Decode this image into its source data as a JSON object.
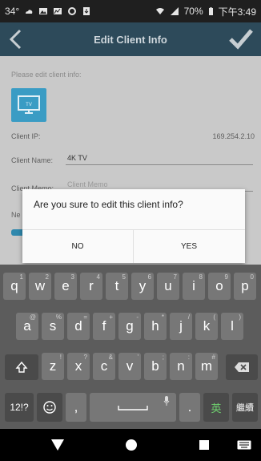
{
  "status_bar": {
    "left_text": "34°",
    "battery": "70%",
    "time": "下午3:49"
  },
  "app_bar": {
    "title": "Edit Client Info"
  },
  "form": {
    "hint": "Please edit client info:",
    "tv_label": "TV",
    "ip_label": "Client IP:",
    "ip_value": "169.254.2.10",
    "name_label": "Client Name:",
    "name_value": "4K TV",
    "memo_label": "Client Memo:",
    "memo_placeholder": "Client Memo",
    "ne_label": "Ne"
  },
  "dialog": {
    "message": "Are you sure to edit this client info?",
    "no_label": "NO",
    "yes_label": "YES"
  },
  "keyboard": {
    "row1": [
      {
        "k": "q",
        "h": "1"
      },
      {
        "k": "w",
        "h": "2"
      },
      {
        "k": "e",
        "h": "3"
      },
      {
        "k": "r",
        "h": "4"
      },
      {
        "k": "t",
        "h": "5"
      },
      {
        "k": "y",
        "h": "6"
      },
      {
        "k": "u",
        "h": "7"
      },
      {
        "k": "i",
        "h": "8"
      },
      {
        "k": "o",
        "h": "9"
      },
      {
        "k": "p",
        "h": "0"
      }
    ],
    "row2": [
      {
        "k": "a",
        "h": "@"
      },
      {
        "k": "s",
        "h": "%"
      },
      {
        "k": "d",
        "h": "="
      },
      {
        "k": "f",
        "h": "+"
      },
      {
        "k": "g",
        "h": "-"
      },
      {
        "k": "h",
        "h": "*"
      },
      {
        "k": "j",
        "h": "/"
      },
      {
        "k": "k",
        "h": "("
      },
      {
        "k": "l",
        "h": ")"
      }
    ],
    "row3": [
      {
        "k": "z",
        "h": "!"
      },
      {
        "k": "x",
        "h": "?"
      },
      {
        "k": "c",
        "h": "&"
      },
      {
        "k": "v",
        "h": "'"
      },
      {
        "k": "b",
        "h": ";"
      },
      {
        "k": "n",
        "h": ":"
      },
      {
        "k": "m",
        "h": "#"
      }
    ],
    "symbols_label": "12!?",
    "comma": ",",
    "period": ".",
    "lang_label": "英",
    "enter_label": "繼續"
  }
}
